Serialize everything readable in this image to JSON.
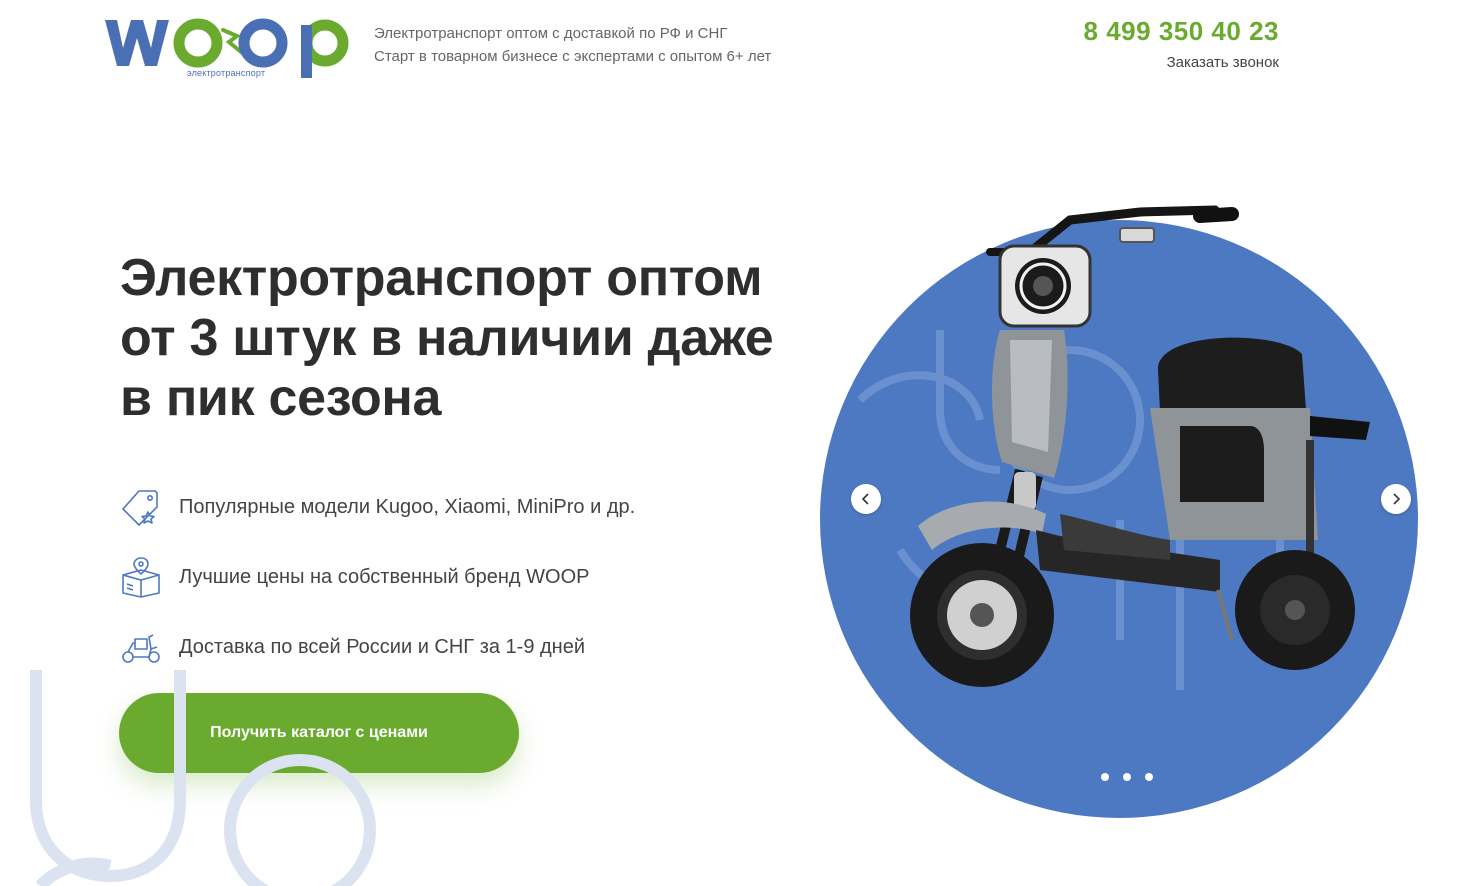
{
  "header": {
    "logo_text": "WOOP",
    "logo_subtitle": "электротранспорт",
    "tagline_line1": "Электротранспорт оптом с доставкой по РФ и СНГ",
    "tagline_line2": "Старт в товарном бизнесе с экспертами с опытом 6+ лет",
    "phone": "8 499 350 40 23",
    "callback_label": "Заказать звонок"
  },
  "hero": {
    "headline_line1": "Электротранспорт оптом",
    "headline_line2": "от 3 штук в наличии даже",
    "headline_line3": "в пик сезона",
    "features": [
      {
        "icon": "price-tag-star-icon",
        "text": "Популярные модели Kugoo, Xiaomi, MiniPro и др."
      },
      {
        "icon": "box-location-icon",
        "text": "Лучшие цены на собственный бренд WOOP"
      },
      {
        "icon": "scooter-delivery-icon",
        "text": "Доставка по всей России и СНГ за 1-9 дней"
      }
    ],
    "cta_label": "Получить каталог с ценами"
  },
  "slider": {
    "dot_count": 3,
    "active_index": 0
  },
  "colors": {
    "brand_green": "#6aab2f",
    "brand_blue": "#4d79c3",
    "logo_blue": "#4a6fb5"
  }
}
